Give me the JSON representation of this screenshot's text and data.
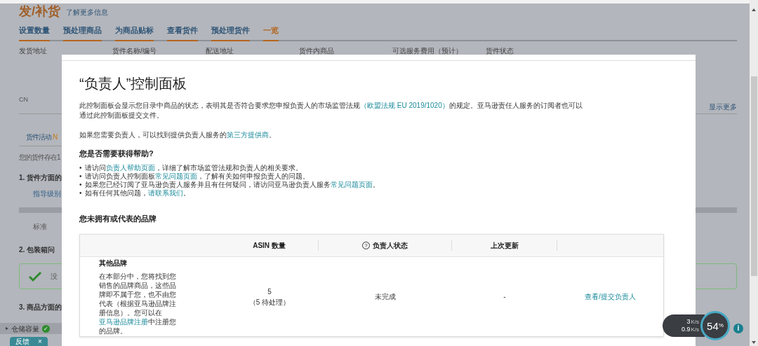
{
  "background": {
    "title": "发/补货",
    "learn_more": "了解更多信息",
    "tabs": [
      {
        "label": "设置数量",
        "selected": false
      },
      {
        "label": "预处理商品",
        "selected": false
      },
      {
        "label": "为商品贴标",
        "selected": false
      },
      {
        "label": "查看货件",
        "selected": false
      },
      {
        "label": "预处理货件",
        "selected": false
      },
      {
        "label": "一览",
        "selected": true
      }
    ],
    "columns": [
      "发货地址",
      "货件名称/编号",
      "配送地址",
      "货件内商品",
      "可选服务费用（预计）",
      "货件状态"
    ],
    "origin_country": "CN",
    "show_more": "显示更多",
    "activity_tab": {
      "label": "货件活动",
      "badge": "N"
    },
    "notice": "您的货件存在1",
    "sections": [
      {
        "heading": "1. 货件方面的",
        "kind": "table",
        "column": "指导级别",
        "cell": "标准"
      },
      {
        "heading": "2. 包装箱问",
        "kind": "status",
        "message": "没"
      },
      {
        "heading": "3. 商品方面的",
        "kind": "empty"
      }
    ],
    "bottom_bar": {
      "expand_glyph": "▸",
      "label": "仓储容量",
      "ok": true,
      "check_glyph": "✓"
    },
    "feedback": {
      "label": "反馈",
      "close": "×"
    }
  },
  "modal": {
    "title": "“负责人”控制面板",
    "intro": {
      "before": "此控制面板会显示您目录中商品的状态，表明其是否符合要求您申报负责人的市场监管法规",
      "link": "（欧盟法规 EU 2019/1020）",
      "after": "的规定。亚马逊责任人服务的订阅者也可以通过此控制面板提交文件。"
    },
    "provider_text": {
      "before": "如果您需要负责人，可以找到提供负责人服务的",
      "link": "第三方提供商",
      "after": "。"
    },
    "help_heading": "您是否需要获得帮助?",
    "help_items": [
      {
        "bullet": "•",
        "before": "请访问",
        "link": "负责人帮助页面",
        "after": "，详细了解市场监管法规和负责人的相关要求。"
      },
      {
        "bullet": "•",
        "before": "请访问负责人控制面板",
        "link": "常见问题页面",
        "after": "，了解有关如何申报负责人的问题。"
      },
      {
        "bullet": "•",
        "before": "如果您已经订阅了亚马逊负责人服务并且有任何疑问，请访问亚马逊负责人服务",
        "link": "常见问题页面",
        "after": "。"
      },
      {
        "bullet": "•",
        "before": "如有任何其他问题，",
        "link": "请联系我们",
        "after": "。"
      }
    ],
    "brands_heading": "您未拥有或代表的品牌",
    "table": {
      "help_glyph": "?",
      "columns": [
        {
          "label": "ASIN 数量",
          "help_icon": false
        },
        {
          "label": "负责人状态",
          "help_icon": true
        },
        {
          "label": "上次更新",
          "help_icon": false
        }
      ],
      "rows": [
        {
          "brand": "其他品牌",
          "description": {
            "before": "在本部分中，您将找到您销售的品牌商品，这些品牌即不属于您，也不由您代表（根据亚马逊品牌注册信息）。您可以在",
            "link": "亚马逊品牌注册",
            "after": "中注册您的品牌。"
          },
          "asin_count": "5",
          "pending": "（5 待处理）",
          "status": "未完成",
          "last_updated": "-",
          "action": "查看/提交负责人"
        }
      ]
    }
  },
  "info_glyph": "i",
  "speed_widget": {
    "upload": "3",
    "upload_unit": "K/s",
    "download": "0.9",
    "download_unit": "K/s",
    "percent": "54",
    "percent_sign": "%"
  }
}
